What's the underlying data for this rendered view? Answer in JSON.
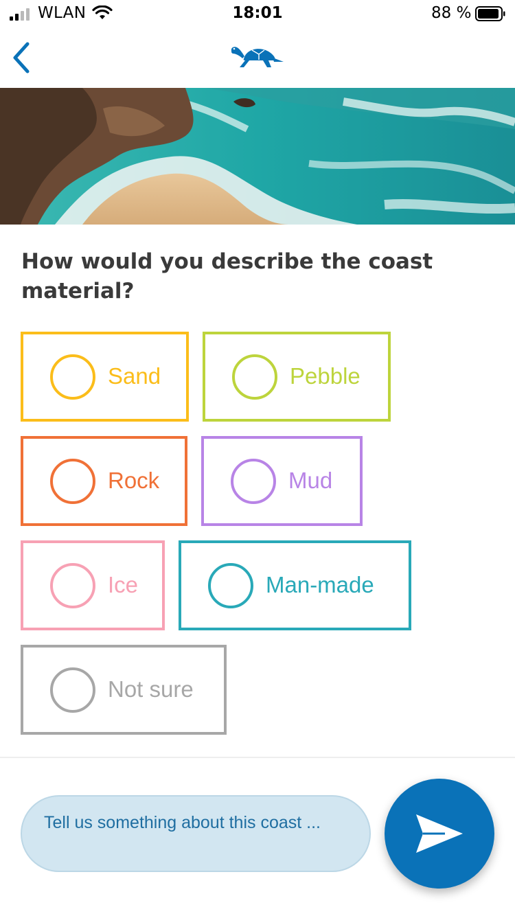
{
  "status_bar": {
    "carrier": "WLAN",
    "time": "18:01",
    "battery": "88 %"
  },
  "nav": {
    "back_icon": "chevron-left-icon",
    "logo_icon": "turtle-icon"
  },
  "hero": {
    "image": "coast-beach-photo"
  },
  "question": "How would you describe the coast material?",
  "options": [
    {
      "label": "Sand",
      "color": "#fbbd1a"
    },
    {
      "label": "Pebble",
      "color": "#bdd43c"
    },
    {
      "label": "Rock",
      "color": "#f07137"
    },
    {
      "label": "Mud",
      "color": "#b884e6"
    },
    {
      "label": "Ice",
      "color": "#f7a1b4"
    },
    {
      "label": "Man-made",
      "color": "#29a9b8"
    },
    {
      "label": "Not sure",
      "color": "#a7a7a7"
    }
  ],
  "comment": {
    "placeholder": "Tell us something about this coast ..."
  },
  "send": {
    "icon": "send-icon",
    "color": "#0a72b8"
  }
}
